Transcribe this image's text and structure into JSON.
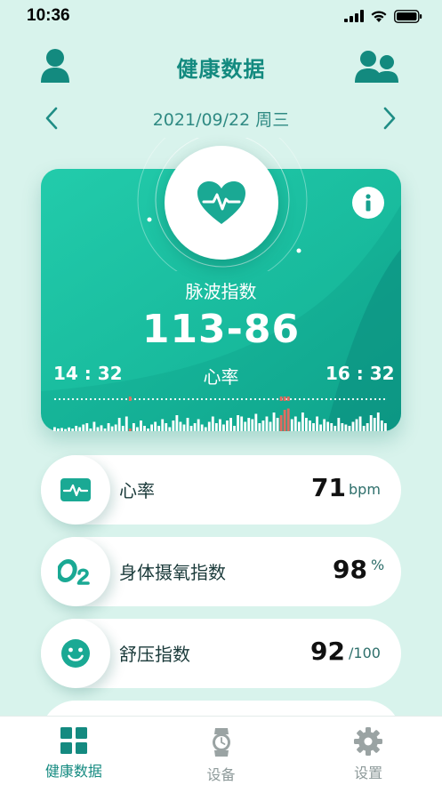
{
  "status": {
    "time": "10:36"
  },
  "header": {
    "title": "健康数据"
  },
  "date": {
    "text": "2021/09/22 周三"
  },
  "card": {
    "label": "脉波指数",
    "value": "113-86",
    "time_start": "14 : 32",
    "time_end": "16 : 32",
    "chart_label": "心率"
  },
  "chart_data": {
    "type": "bar",
    "series": [
      {
        "values": [
          0.15,
          0.1,
          0.12,
          0.08,
          0.14,
          0.1,
          0.2,
          0.15,
          0.25,
          0.3,
          0.1,
          0.35,
          0.15,
          0.22,
          0.1,
          0.3,
          0.18,
          0.25,
          0.5,
          0.2,
          0.55,
          0.1,
          0.3,
          0.15,
          0.4,
          0.2,
          0.1,
          0.25,
          0.35,
          0.2,
          0.45,
          0.3,
          0.15,
          0.4,
          0.6,
          0.35,
          0.25,
          0.5,
          0.2,
          0.3,
          0.45,
          0.25,
          0.15,
          0.35,
          0.55,
          0.3,
          0.45,
          0.25,
          0.4,
          0.5,
          0.2,
          0.6,
          0.55,
          0.35,
          0.5,
          0.45,
          0.65,
          0.3,
          0.4,
          0.55,
          0.35,
          0.7,
          0.5,
          0.6,
          0.8,
          0.85,
          0.45,
          0.55,
          0.35,
          0.7,
          0.5,
          0.4,
          0.3,
          0.55,
          0.25,
          0.45,
          0.35,
          0.3,
          0.2,
          0.5,
          0.3,
          0.25,
          0.2,
          0.35,
          0.45,
          0.55,
          0.2,
          0.3,
          0.6,
          0.5,
          0.7,
          0.4,
          0.3
        ]
      }
    ],
    "highlight_indices": [
      21,
      63,
      64,
      65
    ]
  },
  "metrics": [
    {
      "name": "心率",
      "value": "71",
      "unit": "bpm",
      "icon": "heart-rate-icon"
    },
    {
      "name": "身体摄氧指数",
      "value": "98",
      "unit": "%",
      "icon": "o2-icon"
    },
    {
      "name": "舒压指数",
      "value": "92",
      "unit": "/100",
      "icon": "smile-icon"
    }
  ],
  "tabs": [
    {
      "label": "健康数据",
      "icon": "grid-icon",
      "active": true
    },
    {
      "label": "设备",
      "icon": "watch-icon",
      "active": false
    },
    {
      "label": "设置",
      "icon": "gear-icon",
      "active": false
    }
  ],
  "colors": {
    "brand": "#17a08f",
    "background": "#d8f3ec",
    "highlight_bar": "#e26b5f"
  }
}
